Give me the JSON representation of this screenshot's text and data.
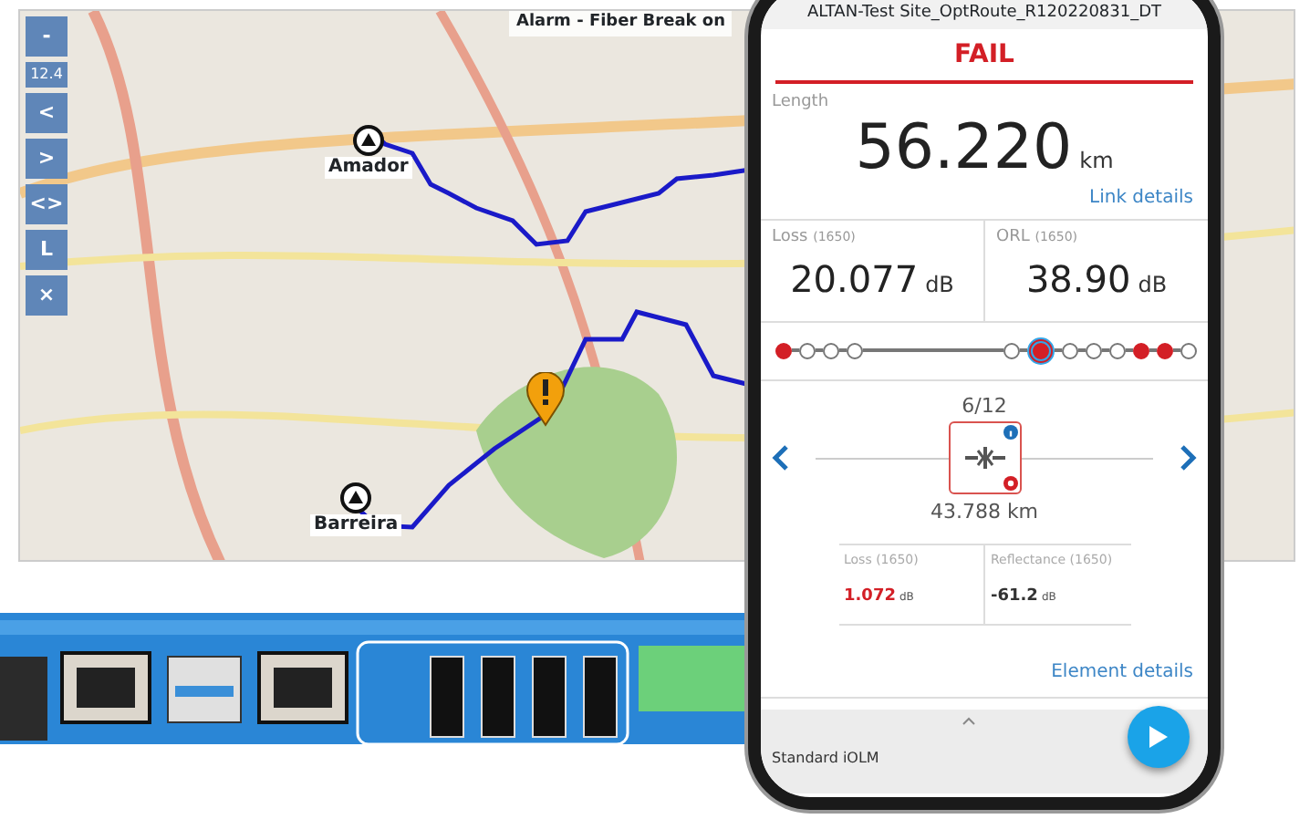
{
  "map": {
    "controls": [
      {
        "kind": "button",
        "label": "-"
      },
      {
        "kind": "readout",
        "label": "12.4"
      },
      {
        "kind": "button",
        "label": "<"
      },
      {
        "kind": "button",
        "label": ">"
      },
      {
        "kind": "button",
        "label": "<>"
      },
      {
        "kind": "button",
        "label": "L"
      },
      {
        "kind": "button",
        "label": "×"
      }
    ],
    "alarm": "Alarm - Fiber Break on",
    "sites": [
      {
        "label": "Amador"
      },
      {
        "label": "Barreira"
      }
    ]
  },
  "phone": {
    "title": "ALTAN-Test Site_OptRoute_R120220831_DT",
    "verdict": "FAIL",
    "failed": true,
    "length": {
      "label": "Length",
      "value": "56.220",
      "unit": "km"
    },
    "link_details": "Link details",
    "loss": {
      "label": "Loss",
      "wavelength": "(1650)",
      "value": "20.077",
      "unit": "dB"
    },
    "orl": {
      "label": "ORL",
      "wavelength": "(1650)",
      "value": "38.90",
      "unit": "dB"
    },
    "events": [
      {
        "kind": "event",
        "failed": true,
        "selected": false
      },
      {
        "kind": "event",
        "failed": false,
        "selected": false
      },
      {
        "kind": "event",
        "failed": false,
        "selected": false
      },
      {
        "kind": "event",
        "failed": false,
        "selected": false
      },
      {
        "kind": "span"
      },
      {
        "kind": "event",
        "failed": false,
        "selected": false
      },
      {
        "kind": "event",
        "failed": true,
        "selected": true
      },
      {
        "kind": "event",
        "failed": false,
        "selected": false
      },
      {
        "kind": "event",
        "failed": false,
        "selected": false
      },
      {
        "kind": "event",
        "failed": false,
        "selected": false
      },
      {
        "kind": "event",
        "failed": true,
        "selected": false
      },
      {
        "kind": "event",
        "failed": true,
        "selected": false
      },
      {
        "kind": "event",
        "failed": false,
        "selected": false
      }
    ],
    "element": {
      "position": "6/12",
      "distance": "43.788 km",
      "failed": true,
      "loss": {
        "label": "Loss (1650)",
        "value": "1.072",
        "unit": "dB",
        "failed": true
      },
      "reflectance": {
        "label": "Reflectance (1650)",
        "value": "-61.2",
        "unit": "dB",
        "failed": false
      }
    },
    "element_details": "Element details",
    "bottom": {
      "label": "Standard iOLM"
    }
  }
}
